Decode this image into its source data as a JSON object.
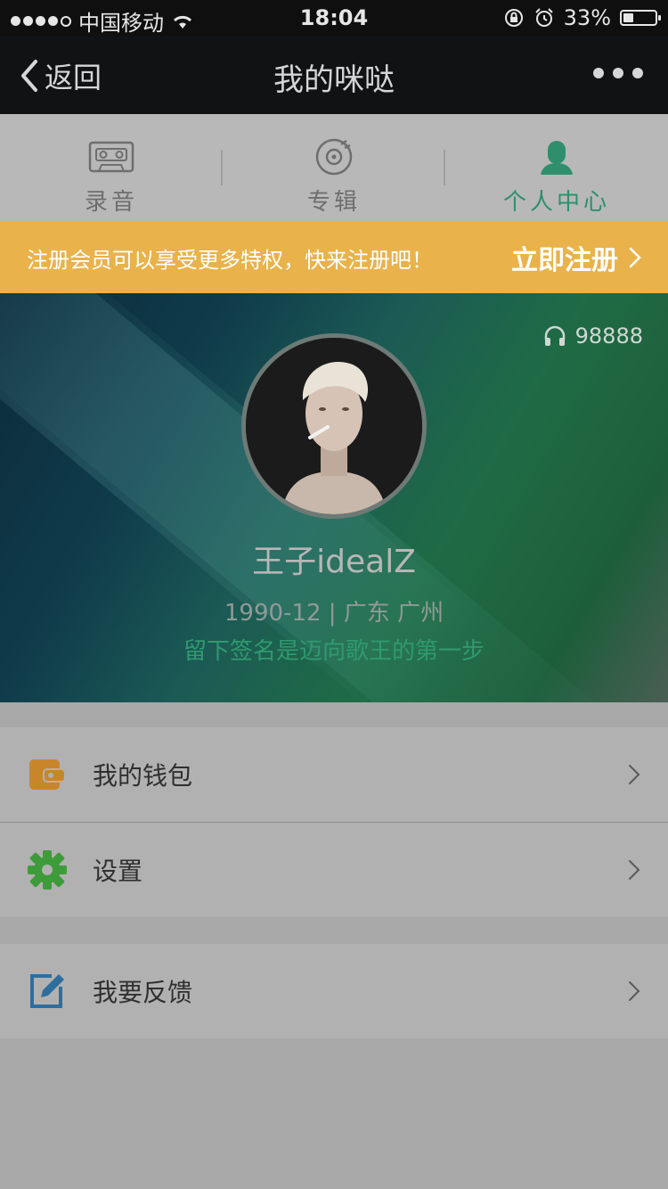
{
  "status": {
    "carrier": "中国移动",
    "time": "18:04",
    "battery": "33%",
    "battery_level": 0.33
  },
  "nav": {
    "back_label": "返回",
    "title": "我的咪哒"
  },
  "tabs": [
    {
      "label": "录音",
      "icon": "cassette-icon",
      "active": false
    },
    {
      "label": "专辑",
      "icon": "disc-icon",
      "active": false
    },
    {
      "label": "个人中心",
      "icon": "person-icon",
      "active": true
    }
  ],
  "promo": {
    "message": "注册会员可以享受更多特权，快来注册吧！",
    "cta": "立即注册"
  },
  "profile": {
    "listens": "98888",
    "name": "王子idealZ",
    "meta": "1990-12 | 广东 广州",
    "signature": "留下签名是迈向歌王的第一步"
  },
  "menu": {
    "wallet": "我的钱包",
    "settings": "设置",
    "feedback": "我要反馈"
  },
  "colors": {
    "accent_green": "#2f8f6d",
    "promo_bg": "#e9b24a",
    "wallet_icon": "#c8862a",
    "settings_icon": "#3e9b3a",
    "feedback_icon": "#2e6e9e"
  }
}
